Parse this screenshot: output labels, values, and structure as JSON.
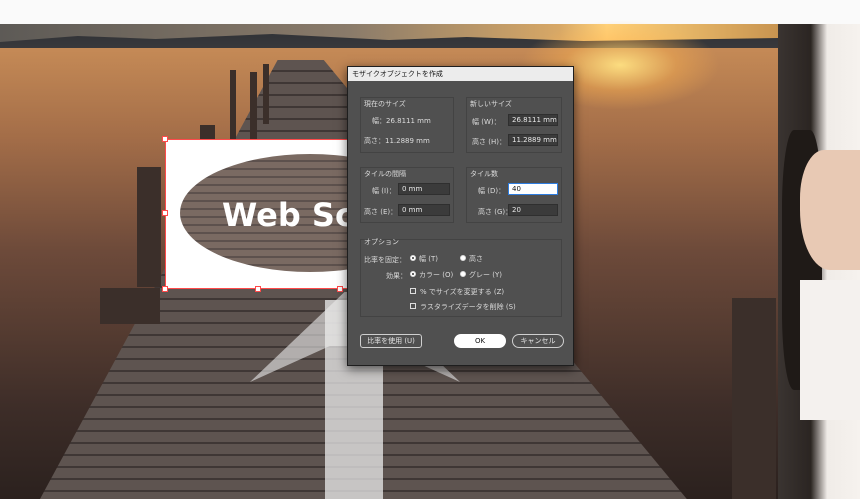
{
  "canvas": {
    "logo_text": "Web Sc"
  },
  "dialog": {
    "title": "モザイクオブジェクトを作成",
    "current_size": {
      "label": "現在のサイズ",
      "width": "幅：26.8111 mm",
      "height": "高さ：11.2889 mm"
    },
    "new_size": {
      "label": "新しいサイズ",
      "width_label": "幅 (W)：",
      "width_value": "26.8111 mm",
      "height_label": "高さ (H)：",
      "height_value": "11.2889 mm"
    },
    "tile_spacing": {
      "label": "タイルの間隔",
      "width_label": "幅 (I)：",
      "width_value": "0 mm",
      "height_label": "高さ (E)：",
      "height_value": "0 mm"
    },
    "tile_count": {
      "label": "タイル数",
      "width_label": "幅 (D)：",
      "width_value": "40",
      "height_label": "高さ (G)：",
      "height_value": "20"
    },
    "options": {
      "label": "オプション",
      "ratio_label": "比率を固定：",
      "ratio_width": "幅 (T)",
      "ratio_height": "高さ",
      "effect_label": "効果：",
      "effect_color": "カラー (O)",
      "effect_gray": "グレー (Y)",
      "resize_percent": "% でサイズを変更する (Z)",
      "delete_raster": "ラスタライズデータを削除 (S)"
    },
    "buttons": {
      "use_ratio": "比率を使用 (U)",
      "ok": "OK",
      "cancel": "キャンセル"
    }
  }
}
